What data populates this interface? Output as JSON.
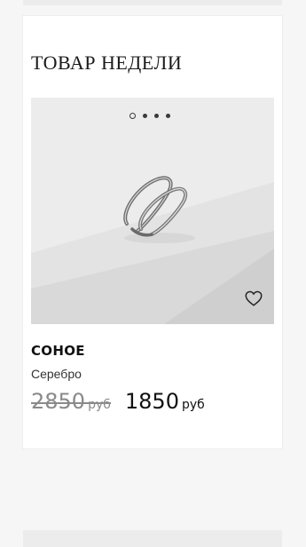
{
  "section": {
    "title": "ТОВАР НЕДЕЛИ"
  },
  "product": {
    "name": "СОНОЕ",
    "material": "Серебро",
    "old_price": "2850",
    "old_price_currency": "руб",
    "new_price": "1850",
    "new_price_currency": "руб",
    "gallery_total": 4,
    "gallery_active_index": 0
  },
  "colors": {
    "background": "#f6f6f6",
    "card": "#ffffff",
    "text": "#1a1a1a",
    "old_price": "#8a8a8a"
  },
  "icons": {
    "favorite": "heart-outline-icon"
  }
}
